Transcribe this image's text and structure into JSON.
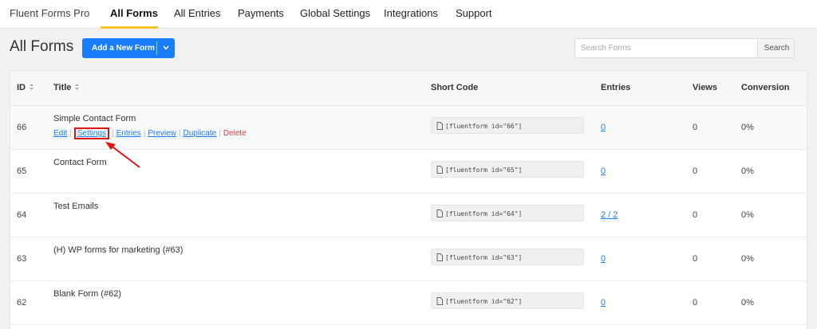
{
  "nav": {
    "brand": "Fluent Forms Pro",
    "items": [
      "All Forms",
      "All Entries",
      "Payments",
      "Global Settings",
      "Integrations",
      "Support"
    ],
    "active": "All Forms",
    "accent": "#f4c430"
  },
  "header": {
    "title": "All Forms",
    "add_button": "Add a New Form",
    "search_placeholder": "Search Forms",
    "search_button": "Search",
    "primary_color": "#1a7efb"
  },
  "table": {
    "columns": [
      "ID",
      "Title",
      "Short Code",
      "Entries",
      "Views",
      "Conversion"
    ],
    "actions": [
      "Edit",
      "Settings",
      "Entries",
      "Preview",
      "Duplicate",
      "Delete"
    ],
    "rows": [
      {
        "id": "66",
        "title": "Simple Contact Form",
        "shortcode": "[fluentform id=\"66\"]",
        "entries": "0",
        "views": "0",
        "conversion": "0%"
      },
      {
        "id": "65",
        "title": "Contact Form",
        "shortcode": "[fluentform id=\"65\"]",
        "entries": "0",
        "views": "0",
        "conversion": "0%"
      },
      {
        "id": "64",
        "title": "Test Emails",
        "shortcode": "[fluentform id=\"64\"]",
        "entries": "2 / 2",
        "views": "0",
        "conversion": "0%"
      },
      {
        "id": "63",
        "title": "(H) WP forms for marketing (#63)",
        "shortcode": "[fluentform id=\"63\"]",
        "entries": "0",
        "views": "0",
        "conversion": "0%"
      },
      {
        "id": "62",
        "title": "Blank Form (#62)",
        "shortcode": "[fluentform id=\"62\"]",
        "entries": "0",
        "views": "0",
        "conversion": "0%"
      }
    ]
  },
  "annotation": {
    "highlight_color": "#e01313",
    "target": "Settings"
  }
}
